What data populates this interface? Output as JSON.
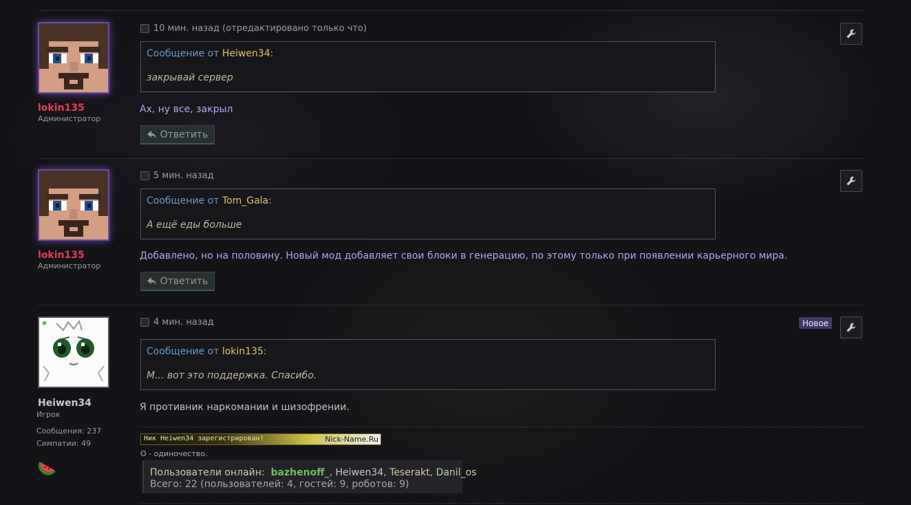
{
  "posts": [
    {
      "author": "lokin135",
      "title": "Администратор",
      "time": "10 мин. назад (отредактировано только что)",
      "quote_prefix": "Сообщение от",
      "quote_author": "Heiwen34",
      "quote_text": "закрывай сервер",
      "message": "Ах, ну все, закрыл",
      "reply_label": "Ответить"
    },
    {
      "author": "lokin135",
      "title": "Администратор",
      "time": "5 мин. назад",
      "quote_prefix": "Сообщение от",
      "quote_author": "Tom_Gala",
      "quote_text": "А ещё еды больше",
      "message": "Добавлено, но на половину. Новый мод добавляет свои блоки в генерацию, по этому только при появлении карьерного мира.",
      "reply_label": "Ответить"
    },
    {
      "author": "Heiwen34",
      "title": "Игрок",
      "time": "4 мин. назад",
      "badge": "Новое",
      "quote_prefix": "Сообщение от",
      "quote_author": "lokin135",
      "quote_text": "М... вот это поддержка. Спасибо.",
      "message": "Я противник наркомании и шизофрении.",
      "stats": {
        "messages_label": "Сообщения:",
        "messages_value": "237",
        "likes_label": "Симпатии:",
        "likes_value": "49"
      },
      "signature": {
        "nick_banner_text": "Ник Heiwen34 зарегистрирован!",
        "nick_banner_site": "Nick-Name.Ru",
        "motto": "О - одиночество.",
        "online_label": "Пользователи онлайн:",
        "online_users": [
          "bazhenoff_",
          "Heiwen34",
          "Teserakt",
          "Danil_os"
        ],
        "online_total": "Всего: 22 (пользователей: 4, гостей: 9, роботов: 9)"
      }
    }
  ],
  "colors": {
    "admin_name": "#ea3a53",
    "quote_link": "#6b97c9",
    "quote_author": "#e3c16f",
    "admin_message": "#b6a4ef",
    "badge_bg": "#3f3a6a"
  },
  "icons": [
    "wrench-icon",
    "reply-arrow-icon",
    "watermelon-icon"
  ]
}
